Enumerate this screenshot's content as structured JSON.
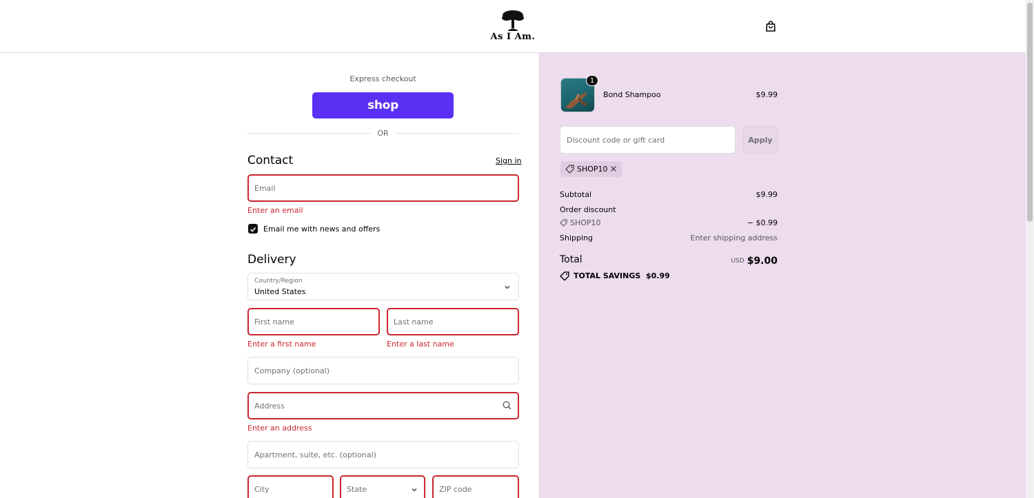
{
  "header": {
    "logo_text": "As I Am.",
    "cart_icon": "shopping-bag-icon"
  },
  "express": {
    "label": "Express checkout",
    "shop_button_label": "shop",
    "or_label": "OR"
  },
  "contact": {
    "title": "Contact",
    "sign_in_label": "Sign in",
    "email_placeholder": "Email",
    "email_error": "Enter an email",
    "newsletter_label": "Email me with news and offers",
    "newsletter_checked": true
  },
  "delivery": {
    "title": "Delivery",
    "country_label": "Country/Region",
    "country_value": "United States",
    "first_name_placeholder": "First name",
    "first_name_error": "Enter a first name",
    "last_name_placeholder": "Last name",
    "last_name_error": "Enter a last name",
    "company_placeholder": "Company (optional)",
    "address_placeholder": "Address",
    "address_error": "Enter an address",
    "apartment_placeholder": "Apartment, suite, etc. (optional)",
    "city_placeholder": "City",
    "state_placeholder": "State",
    "zip_placeholder": "ZIP code"
  },
  "summary": {
    "item": {
      "name": "Bond Shampoo",
      "price": "$9.99",
      "quantity": "1"
    },
    "discount_placeholder": "Discount code or gift card",
    "apply_label": "Apply",
    "applied_code": "SHOP10",
    "subtotal_label": "Subtotal",
    "subtotal_value": "$9.99",
    "order_discount_label": "Order discount",
    "order_discount_code": "SHOP10",
    "order_discount_value": "− $0.99",
    "shipping_label": "Shipping",
    "shipping_value": "Enter shipping address",
    "total_label": "Total",
    "total_currency": "USD",
    "total_value": "$9.00",
    "savings_label": "TOTAL SAVINGS",
    "savings_value": "$0.99"
  },
  "colors": {
    "shop_purple": "#5a31f4",
    "error_red": "#c9242e",
    "summary_bg": "#eddcee"
  }
}
